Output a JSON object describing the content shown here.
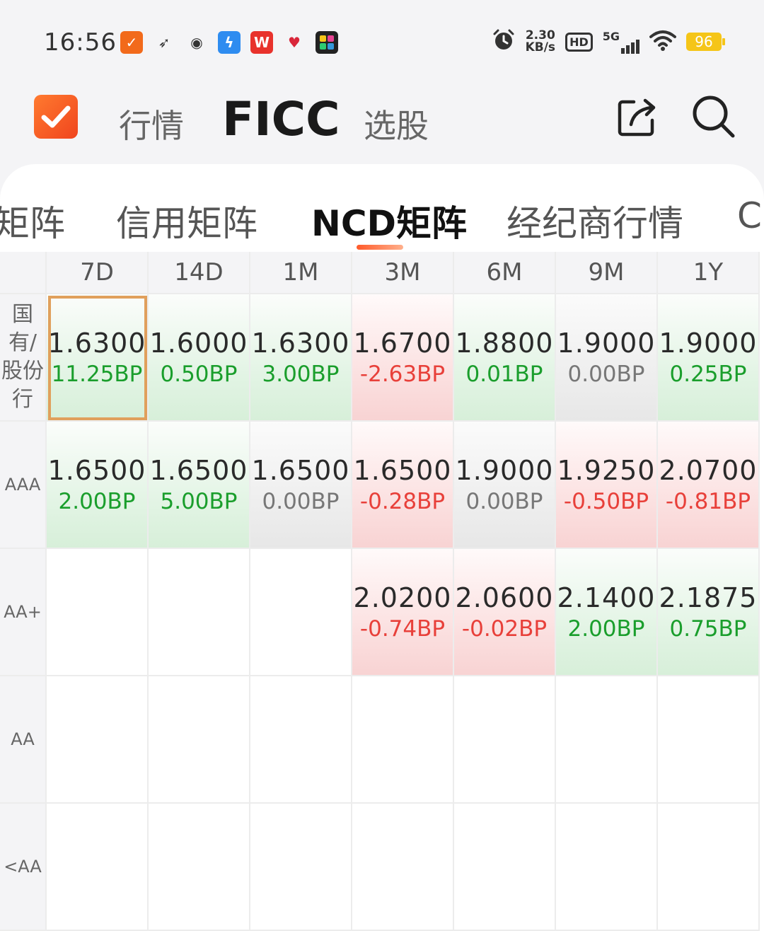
{
  "status_bar": {
    "time": "16:56",
    "speed_value": "2.30",
    "speed_unit": "KB/s",
    "hd_label": "HD",
    "network_label": "5G",
    "battery": "96",
    "notification_icons": [
      "check-icon",
      "feather-icon",
      "weibo-icon",
      "lightning-icon",
      "wps-icon",
      "heart-app-icon",
      "grid-app-icon"
    ],
    "right_icons": [
      "alarm-icon",
      "wifi-icon"
    ]
  },
  "top_nav": {
    "tabs": [
      {
        "label": "行情",
        "active": false
      },
      {
        "label": "FICC",
        "active": true
      },
      {
        "label": "选股",
        "active": false
      }
    ],
    "icons": [
      "share-icon",
      "search-icon"
    ],
    "accent_color": "#f2562b"
  },
  "sub_tabs": [
    {
      "label": "矩阵",
      "active": false
    },
    {
      "label": "信用矩阵",
      "active": false
    },
    {
      "label": "NCD矩阵",
      "active": true
    },
    {
      "label": "经纪商行情",
      "active": false
    },
    {
      "label": "C",
      "active": false
    }
  ],
  "matrix": {
    "columns": [
      "7D",
      "14D",
      "1M",
      "3M",
      "6M",
      "9M",
      "1Y"
    ],
    "rows": [
      {
        "label": "国有/股份行",
        "label_lines": [
          "国",
          "有/",
          "股份",
          "行"
        ],
        "cells": [
          {
            "rate": "1.6300",
            "change": "11.25BP",
            "trend": "up",
            "selected": true
          },
          {
            "rate": "1.6000",
            "change": "0.50BP",
            "trend": "up"
          },
          {
            "rate": "1.6300",
            "change": "3.00BP",
            "trend": "up"
          },
          {
            "rate": "1.6700",
            "change": "-2.63BP",
            "trend": "down"
          },
          {
            "rate": "1.8800",
            "change": "0.01BP",
            "trend": "up"
          },
          {
            "rate": "1.9000",
            "change": "0.00BP",
            "trend": "flat"
          },
          {
            "rate": "1.9000",
            "change": "0.25BP",
            "trend": "up"
          }
        ]
      },
      {
        "label": "AAA",
        "label_lines": [
          "AAA"
        ],
        "cells": [
          {
            "rate": "1.6500",
            "change": "2.00BP",
            "trend": "up"
          },
          {
            "rate": "1.6500",
            "change": "5.00BP",
            "trend": "up"
          },
          {
            "rate": "1.6500",
            "change": "0.00BP",
            "trend": "flat"
          },
          {
            "rate": "1.6500",
            "change": "-0.28BP",
            "trend": "down"
          },
          {
            "rate": "1.9000",
            "change": "0.00BP",
            "trend": "flat"
          },
          {
            "rate": "1.9250",
            "change": "-0.50BP",
            "trend": "down"
          },
          {
            "rate": "2.0700",
            "change": "-0.81BP",
            "trend": "down"
          }
        ]
      },
      {
        "label": "AA+",
        "label_lines": [
          "AA+"
        ],
        "cells": [
          null,
          null,
          null,
          {
            "rate": "2.0200",
            "change": "-0.74BP",
            "trend": "down"
          },
          {
            "rate": "2.0600",
            "change": "-0.02BP",
            "trend": "down"
          },
          {
            "rate": "2.1400",
            "change": "2.00BP",
            "trend": "up"
          },
          {
            "rate": "2.1875",
            "change": "0.75BP",
            "trend": "up"
          }
        ]
      },
      {
        "label": "AA",
        "label_lines": [
          "AA"
        ],
        "cells": [
          null,
          null,
          null,
          null,
          null,
          null,
          null
        ]
      },
      {
        "label": "<AA",
        "label_lines": [
          "<AA"
        ],
        "cells": [
          null,
          null,
          null,
          null,
          null,
          null,
          null
        ]
      }
    ],
    "colors": {
      "up": "#1a9e2c",
      "down": "#e8403a",
      "flat": "#777777",
      "selected_border": "#e0a05c"
    }
  }
}
